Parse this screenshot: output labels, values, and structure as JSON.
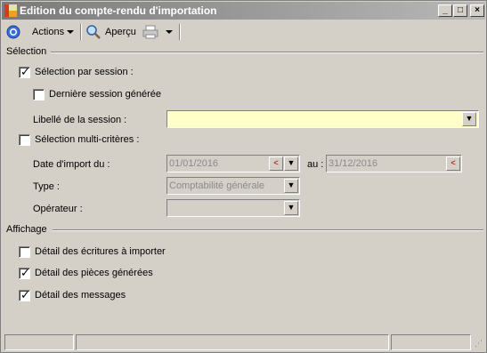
{
  "window": {
    "title": "Edition du compte-rendu d'importation"
  },
  "toolbar": {
    "actions_label": "Actions",
    "preview_label": "Aperçu"
  },
  "selection": {
    "group_label": "Sélection",
    "by_session_label": "Sélection par session :",
    "by_session_checked": true,
    "last_session_label": "Dernière session générée",
    "last_session_checked": false,
    "session_name_label": "Libellé de la session :",
    "session_name_value": "",
    "multi_criteria_label": "Sélection multi-critères :",
    "multi_criteria_checked": false,
    "import_date_label": "Date d'import du :",
    "date_from": "01/01/2016",
    "date_to_label": "au :",
    "date_to": "31/12/2016",
    "type_label": "Type :",
    "type_value": "Comptabilité générale",
    "operator_label": "Opérateur :",
    "operator_value": ""
  },
  "display": {
    "group_label": "Affichage",
    "detail_entries_label": "Détail des écritures à importer",
    "detail_entries_checked": false,
    "detail_documents_label": "Détail des pièces générées",
    "detail_documents_checked": true,
    "detail_messages_label": "Détail des messages",
    "detail_messages_checked": true
  },
  "colors": {
    "highlight_field": "#ffffc8",
    "window_bg": "#d4d0c8"
  },
  "icons": [
    "app-icon",
    "actions-icon",
    "preview-icon",
    "print-icon",
    "calendar-icon",
    "dropdown-icon"
  ]
}
